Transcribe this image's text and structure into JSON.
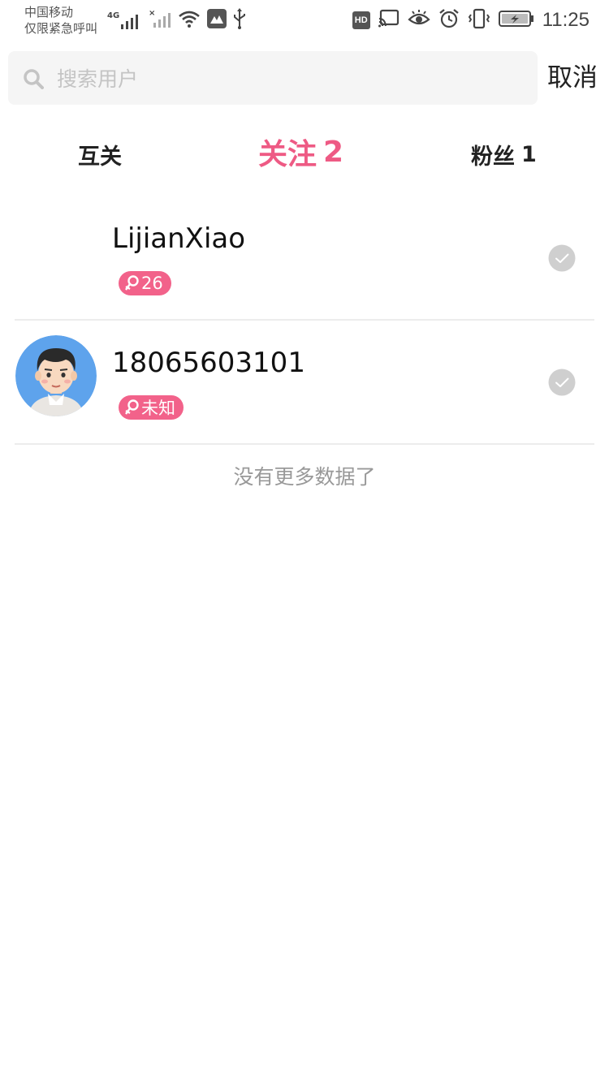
{
  "status_bar": {
    "carrier_line1": "中国移动",
    "carrier_line2": "仅限紧急呼叫",
    "network": "4G",
    "hd_label": "HD",
    "time": "11:25"
  },
  "search": {
    "placeholder": "搜索用户",
    "value": "",
    "cancel_label": "取消"
  },
  "tabs": [
    {
      "label": "互关",
      "count": "",
      "active": false
    },
    {
      "label": "关注",
      "count": "2",
      "active": true
    },
    {
      "label": "粉丝",
      "count": "1",
      "active": false
    }
  ],
  "users": [
    {
      "name": "LijianXiao",
      "badge": "26",
      "has_avatar": false,
      "checked": false
    },
    {
      "name": "18065603101",
      "badge": "未知",
      "has_avatar": true,
      "checked": false
    }
  ],
  "footer": {
    "no_more": "没有更多数据了"
  },
  "colors": {
    "accent": "#ee5a84",
    "badge": "#f2628a",
    "divider": "#ececec",
    "search_bg": "#f5f5f5"
  },
  "icons": {
    "search": "search-icon",
    "check": "check-circle-icon",
    "gender": "female-icon"
  }
}
